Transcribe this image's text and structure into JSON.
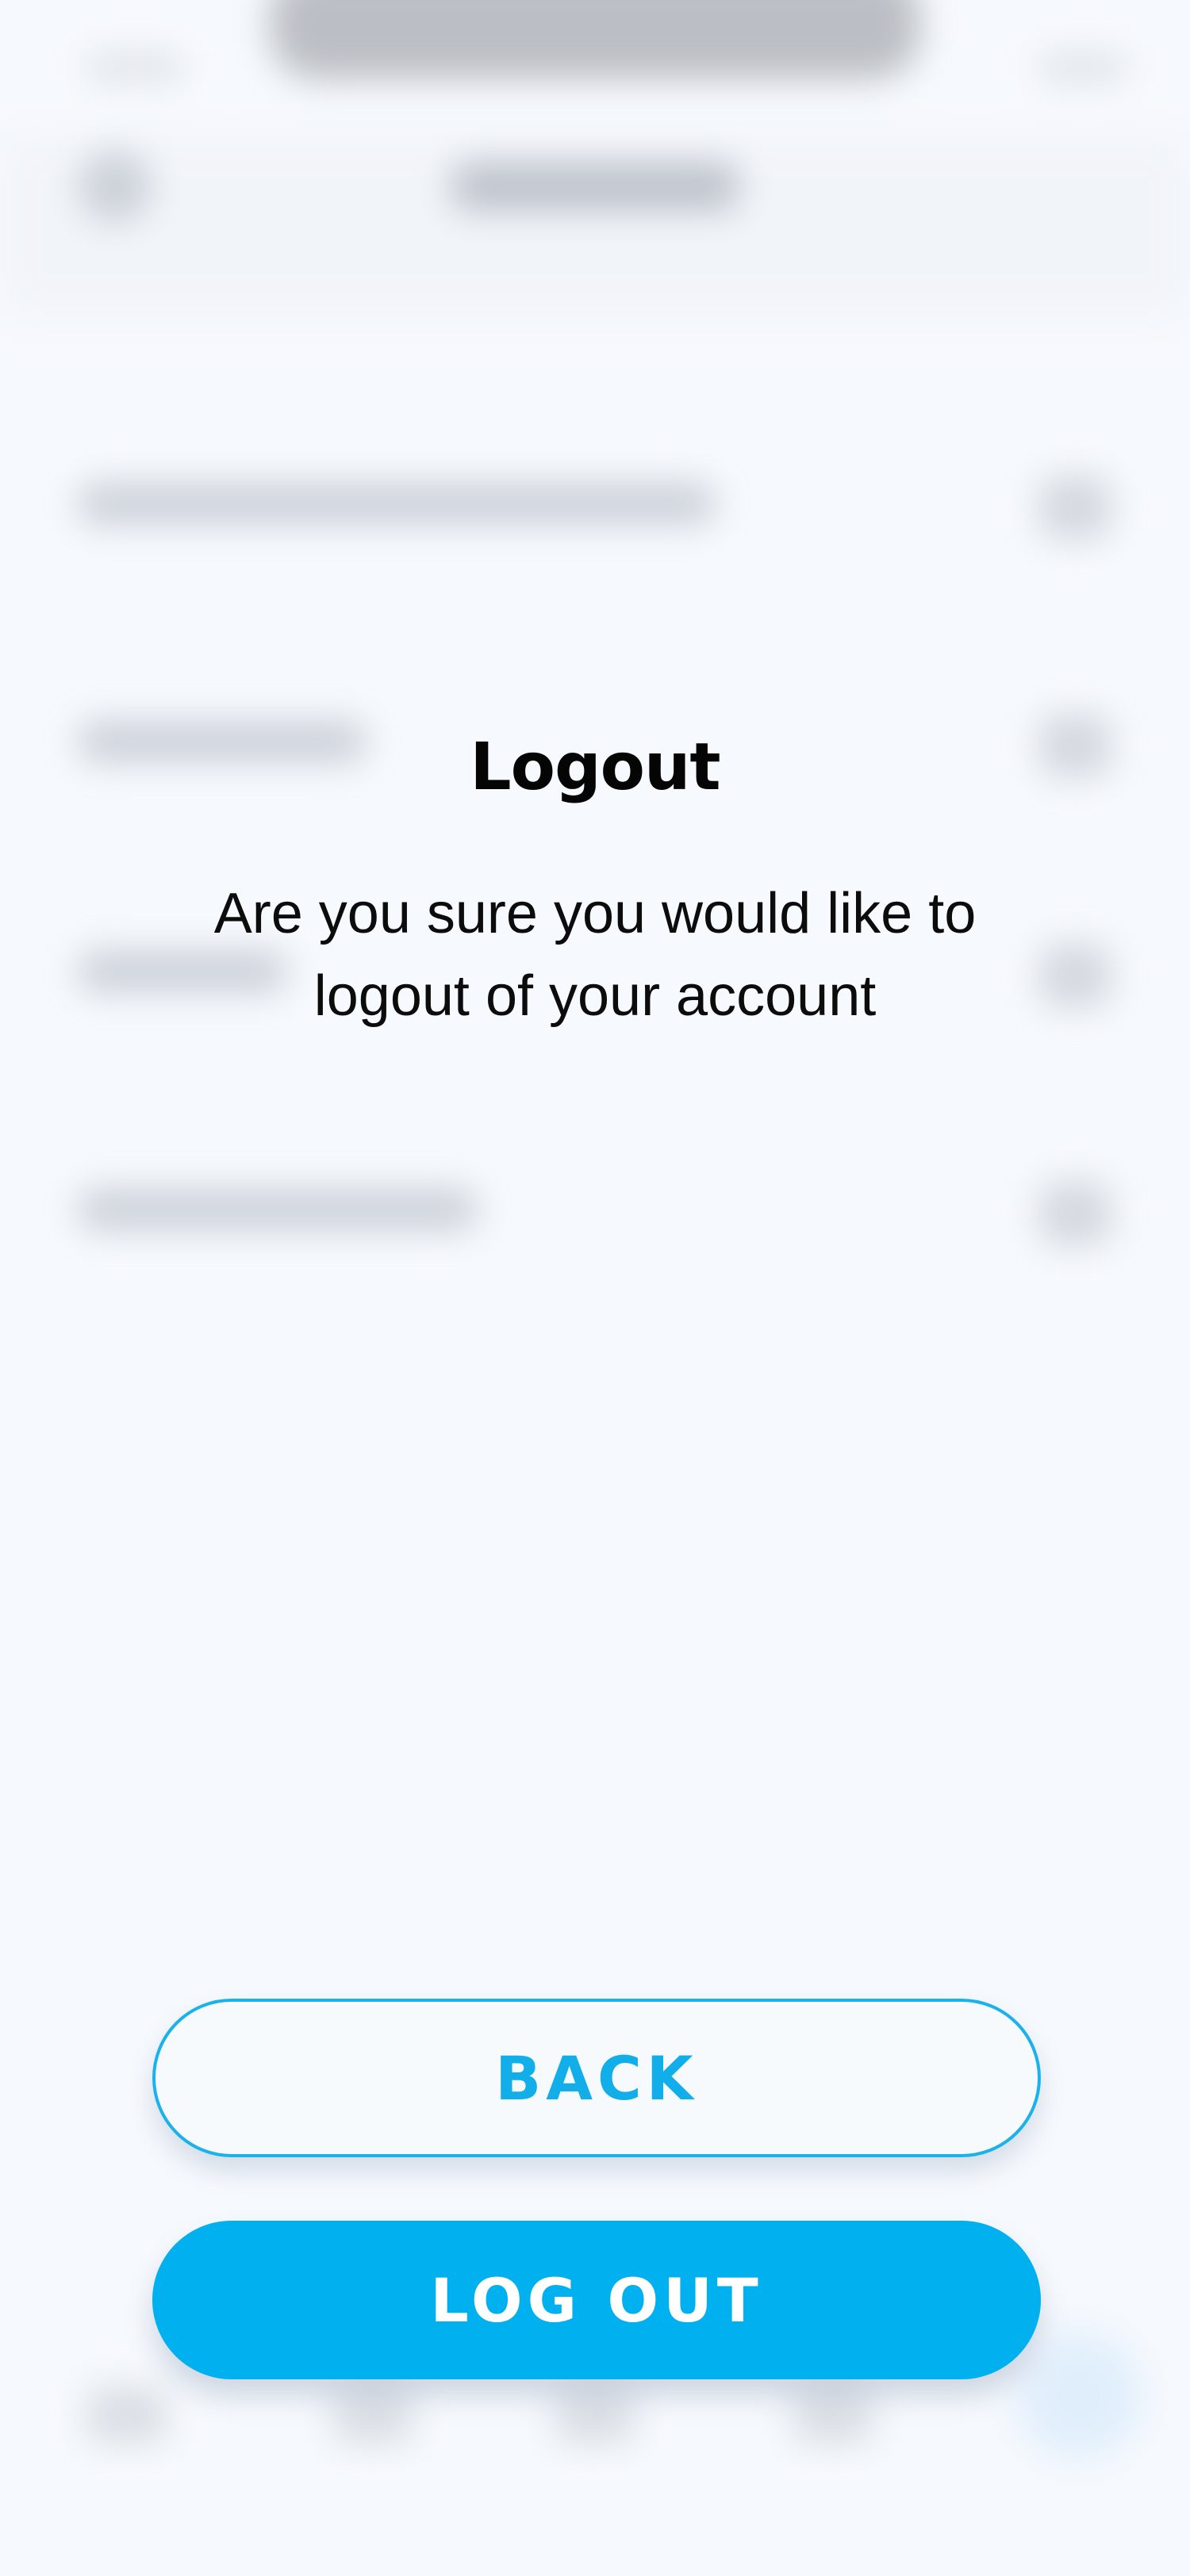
{
  "dialog": {
    "title": "Logout",
    "message": "Are you sure you would like to logout of your account",
    "back_label": "BACK",
    "logout_label": "LOG OUT"
  },
  "colors": {
    "accent": "#00b0ef",
    "background": "#f6f9fd",
    "text": "#050505"
  }
}
